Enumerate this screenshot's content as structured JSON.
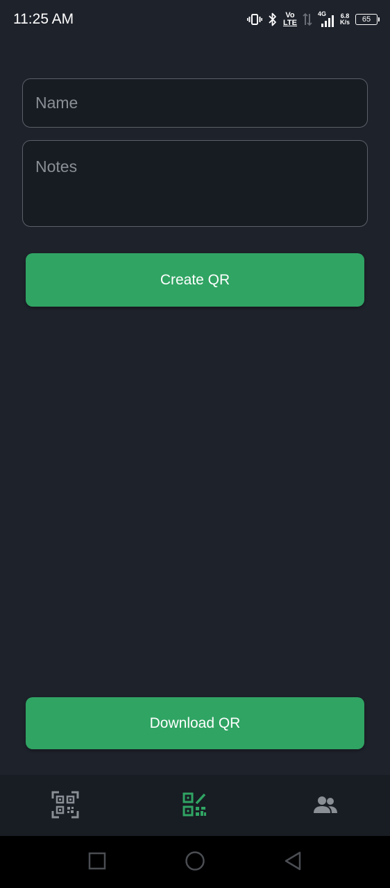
{
  "status_bar": {
    "time": "11:25 AM",
    "network_type": "4G",
    "volte_top": "Vo",
    "volte_bottom": "LTE",
    "speed_value": "6.8",
    "speed_unit": "K/s",
    "battery_level": "65"
  },
  "form": {
    "name_placeholder": "Name",
    "notes_placeholder": "Notes",
    "name_value": "",
    "notes_value": ""
  },
  "buttons": {
    "create_label": "Create QR",
    "download_label": "Download QR"
  },
  "bottom_nav": {
    "items": [
      {
        "icon": "qr-scan-icon",
        "active": false
      },
      {
        "icon": "qr-create-icon",
        "active": true
      },
      {
        "icon": "people-icon",
        "active": false
      }
    ]
  },
  "colors": {
    "background": "#1e222b",
    "accent": "#30a463",
    "field_border": "#5c6068",
    "nav_background": "#181c23",
    "inactive_icon": "#8a8e95"
  }
}
